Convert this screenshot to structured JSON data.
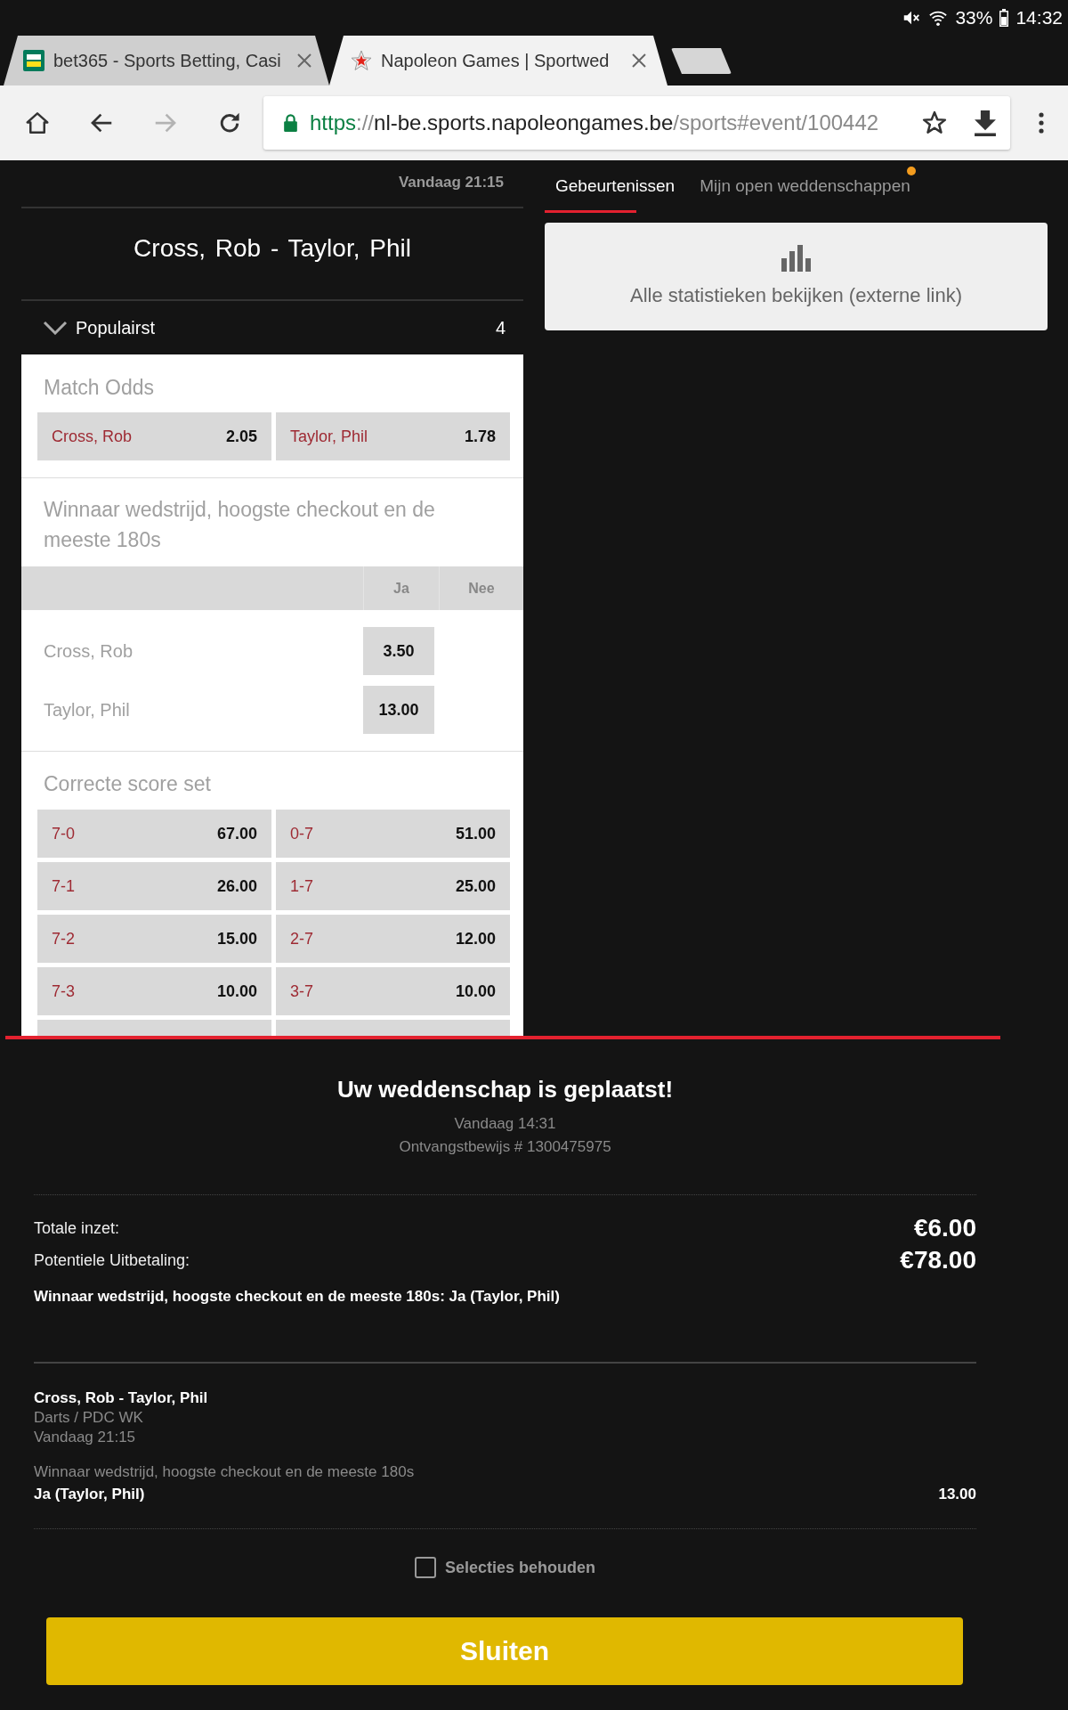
{
  "status_bar": {
    "battery": "33%",
    "time": "14:32"
  },
  "browser": {
    "tabs": [
      {
        "title": "bet365 - Sports Betting, Casi",
        "selected": false
      },
      {
        "title": "Napoleon Games | Sportwed",
        "selected": true
      }
    ],
    "forward_disabled": true,
    "url": [
      {
        "text": "https",
        "kind": "scheme"
      },
      {
        "text": "://",
        "kind": "muted"
      },
      {
        "text": "nl-be.sports.napoleongames.be",
        "kind": "host"
      },
      {
        "text": "/sports#event/100442",
        "kind": "muted"
      }
    ]
  },
  "event": {
    "time": "Vandaag 21:15",
    "title": "Cross, Rob - Taylor, Phil"
  },
  "group": {
    "title": "Populairst",
    "count": "4",
    "expanded": true
  },
  "markets": [
    {
      "kind": "buttons",
      "title": "Match Odds",
      "selections": [
        {
          "label": "Cross, Rob",
          "odds": "2.05"
        },
        {
          "label": "Taylor, Phil",
          "odds": "1.78"
        }
      ]
    },
    {
      "kind": "yes_no",
      "title": "Winnaar wedstrijd, hoogste checkout en de meeste 180s",
      "columns": [
        "Ja",
        "Nee"
      ],
      "rows": [
        {
          "label": "Cross, Rob",
          "yes": "3.50"
        },
        {
          "label": "Taylor, Phil",
          "yes": "13.00"
        }
      ]
    },
    {
      "kind": "buttons",
      "title": "Correcte score set",
      "truncated": true,
      "selections": [
        {
          "label": "7-0",
          "odds": "67.00"
        },
        {
          "label": "0-7",
          "odds": "51.00"
        },
        {
          "label": "7-1",
          "odds": "26.00"
        },
        {
          "label": "1-7",
          "odds": "25.00"
        },
        {
          "label": "7-2",
          "odds": "15.00"
        },
        {
          "label": "2-7",
          "odds": "12.00"
        },
        {
          "label": "7-3",
          "odds": "10.00"
        },
        {
          "label": "3-7",
          "odds": "10.00"
        }
      ]
    }
  ],
  "side_tabs": [
    {
      "label": "Gebeurtenissen",
      "selected": true,
      "notification": false
    },
    {
      "label": "Mijn open weddenschappen",
      "selected": false,
      "notification": true
    }
  ],
  "stats_link": {
    "label": "Alle statistieken bekijken (externe link)"
  },
  "bet_slip": {
    "title": "Uw weddenschap is geplaatst!",
    "date": "Vandaag 14:31",
    "receipt": "Ontvangstbewijs # 1300475975",
    "totals": [
      {
        "label": "Totale inzet:",
        "value": "€6.00"
      },
      {
        "label": "Potentiele Uitbetaling:",
        "value": "€78.00"
      }
    ],
    "summary": "Winnaar wedstrijd, hoogste checkout en de meeste 180s: Ja (Taylor, Phil)",
    "bets": [
      {
        "event": "Cross, Rob - Taylor, Phil",
        "competition": "Darts / PDC WK",
        "time": "Vandaag 21:15",
        "market": "Winnaar wedstrijd, hoogste checkout en de meeste 180s",
        "selection": "Ja (Taylor, Phil)",
        "odds": "13.00"
      }
    ],
    "keep_selections": {
      "label": "Selecties behouden",
      "checked": false
    },
    "close_button": "Sluiten"
  }
}
